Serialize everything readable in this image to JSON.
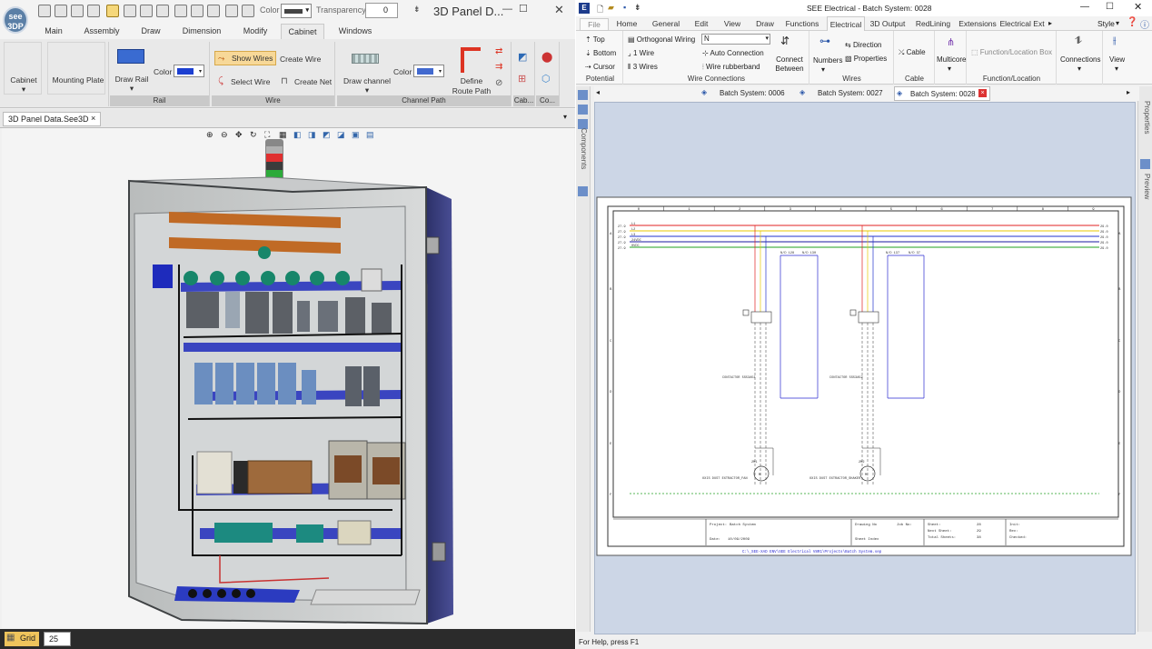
{
  "left": {
    "window_title": "3D Panel D...",
    "logo_text": "see 3DP",
    "toolbar": {
      "color_label": "Color",
      "transparency_label": "Transparency",
      "transparency_value": "0"
    },
    "menu_tabs": [
      "Main",
      "Assembly",
      "Draw",
      "Dimension",
      "Modify",
      "Cabinet",
      "Windows"
    ],
    "active_tab": "Cabinet",
    "ribbon": {
      "cabinet_label": "Cabinet",
      "mounting_plate_label": "Mounting Plate",
      "draw_rail_label": "Draw Rail",
      "color_label": "Color",
      "rail_group": "Rail",
      "show_wires": "Show Wires",
      "create_wire": "Create Wire",
      "select_wire": "Select Wire",
      "create_net": "Create Net",
      "wire_group": "Wire",
      "draw_channel": "Draw channel",
      "channel_color_label": "Color",
      "define_route_path": "Define Route Path",
      "channel_path_group": "Channel Path",
      "cab_group": "Cab...",
      "co_group": "Co..."
    },
    "document_tab": "3D Panel Data.See3D",
    "status": {
      "grid_label": "Grid",
      "grid_value": "25"
    }
  },
  "right": {
    "window_title": "SEE Electrical - Batch System: 0028",
    "ribbon_tabs": [
      "File",
      "Home",
      "General",
      "Edit",
      "View",
      "Draw",
      "Functions",
      "Electrical",
      "3D Output",
      "RedLining",
      "Extensions",
      "Electrical Ext"
    ],
    "active_tab": "Electrical",
    "style_label": "Style",
    "groups": {
      "potential": {
        "title": "Potential",
        "items": [
          "Top",
          "Bottom",
          "Cursor"
        ]
      },
      "wire_connections": {
        "title": "Wire Connections",
        "orthogonal_wiring": "Orthogonal Wiring",
        "wiring_value": "N",
        "one_wire": "1 Wire",
        "three_wires": "3 Wires",
        "auto_connection": "Auto Connection",
        "wire_rubberband": "Wire rubberband",
        "connect_between": "Connect Between"
      },
      "wires": {
        "title": "Wires",
        "numbers": "Numbers",
        "direction": "Direction",
        "properties": "Properties"
      },
      "cable": {
        "title": "Cable",
        "cable": "Cable"
      },
      "multicore": "Multicore",
      "function_location": {
        "title": "Function/Location",
        "box": "Function/Location Box"
      },
      "connections": "Connections",
      "view": "View"
    },
    "side_panels": [
      "Components",
      "Properties",
      "Preview"
    ],
    "sheet_tabs": [
      "Batch System: 0006",
      "Batch System: 0027",
      "Batch System: 0028"
    ],
    "active_sheet": "Batch System: 0028",
    "drawing": {
      "grid_cols": [
        "0",
        "1",
        "2",
        "3",
        "4",
        "5",
        "6",
        "7",
        "8",
        "9"
      ],
      "left_refs": [
        "27.9",
        "27.9",
        "27.9",
        "27.9",
        "27.9"
      ],
      "right_refs": [
        "29.0",
        "29.0",
        "29.0",
        "29.0",
        "29.0"
      ],
      "bus_labels": [
        "L1",
        "L2",
        "L3",
        "24VDC",
        "0VDC"
      ],
      "wire_labels": [
        "N/D 128",
        "N/D 130",
        "N/D 137",
        "N/D 37"
      ],
      "contactor_labels": [
        "CONTACTOR 5S53A51",
        "CONTACTOR 5S53A52"
      ],
      "motor_labels": [
        "OXIS DUST EXTRACTOR_FAN",
        "OXIS DUST EXTRACTOR_SHAKER"
      ],
      "motor_ids": [
        "2M1",
        "2M2"
      ],
      "title_block": {
        "project_label": "Project:",
        "project_value": "Batch System",
        "date_label": "Date:",
        "date_value": "10/09/2009",
        "drawing_no_label": "Drawing No",
        "job_no_label": "Job No:",
        "sheet_index_label": "Sheet Index",
        "sheet_label": "Sheet:",
        "sheet_value": "28",
        "next_sheet_label": "Next Sheet:",
        "next_sheet_value": "29",
        "total_sheets_label": "Total Sheets:",
        "total_sheets_value": "38",
        "init_label": "Init:",
        "rev_label": "Rev:",
        "checked_label": "Checked:"
      },
      "file_path": "C:\\_SEE-XAD ENV\\SEE Electrical V8R1\\Projects\\Batch System.sep"
    },
    "status_text": "For Help, press F1"
  },
  "colors": {
    "l1": "#e02020",
    "l2": "#e8c800",
    "l3": "#2233cc",
    "dc24": "#1a1aa0",
    "dc0": "#22a022",
    "cabinet_door": "#34387a",
    "wire_blue": "#2a2ad0"
  }
}
